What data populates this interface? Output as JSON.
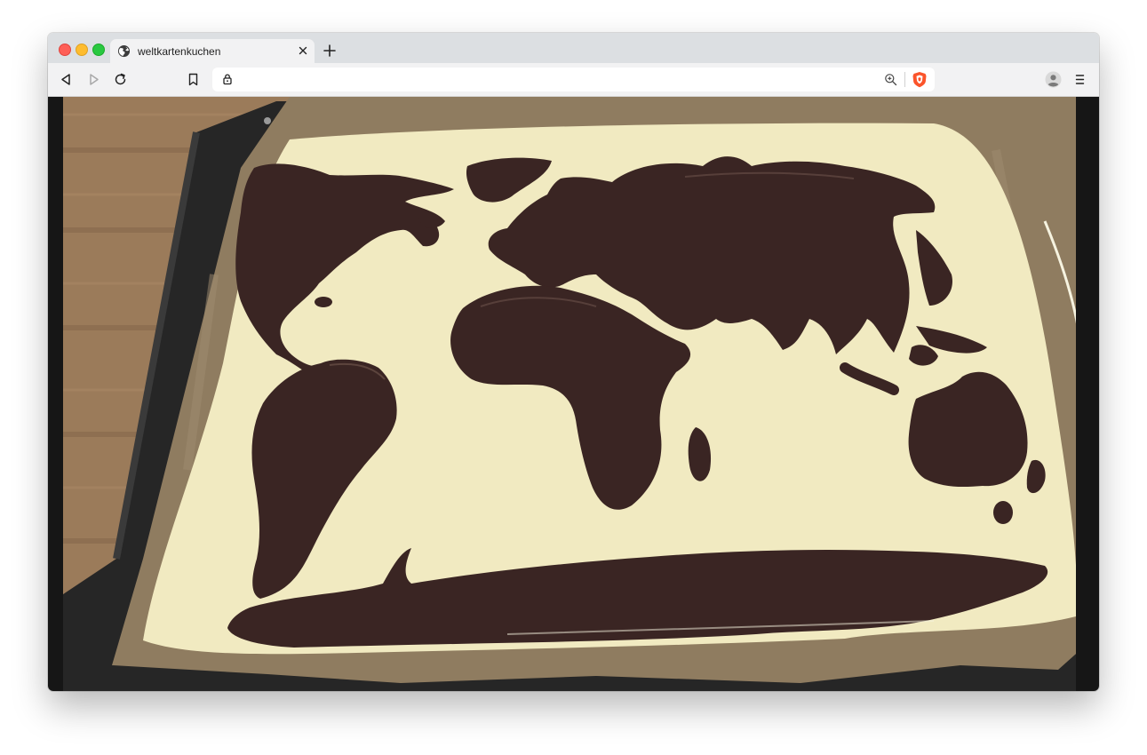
{
  "browser": {
    "tab": {
      "title": "weltkartenkuchen",
      "favicon": "globe-icon"
    },
    "toolbar": {
      "back_icon": "back-arrow-icon",
      "forward_icon": "forward-arrow-icon",
      "reload_icon": "reload-icon",
      "bookmark_icon": "bookmark-icon",
      "profile_icon": "profile-avatar-icon",
      "menu_icon": "hamburger-menu-icon"
    },
    "urlbar": {
      "url": "",
      "lock_icon": "lock-icon",
      "zoom_icon": "zoom-icon",
      "shield_icon": "brave-shield-icon"
    }
  },
  "content": {
    "image": {
      "type": "photo",
      "subject_icon": "world-map-cake-photo"
    }
  },
  "colors": {
    "tabstrip": "#dcdfe2",
    "toolbar": "#f2f2f3",
    "brave_orange": "#fb542b",
    "chocolate": "#3a2523",
    "white_chocolate": "#f1eac1",
    "parchment": "#8f7c60",
    "wood": "#9b7b5a",
    "tray": "#262626"
  }
}
